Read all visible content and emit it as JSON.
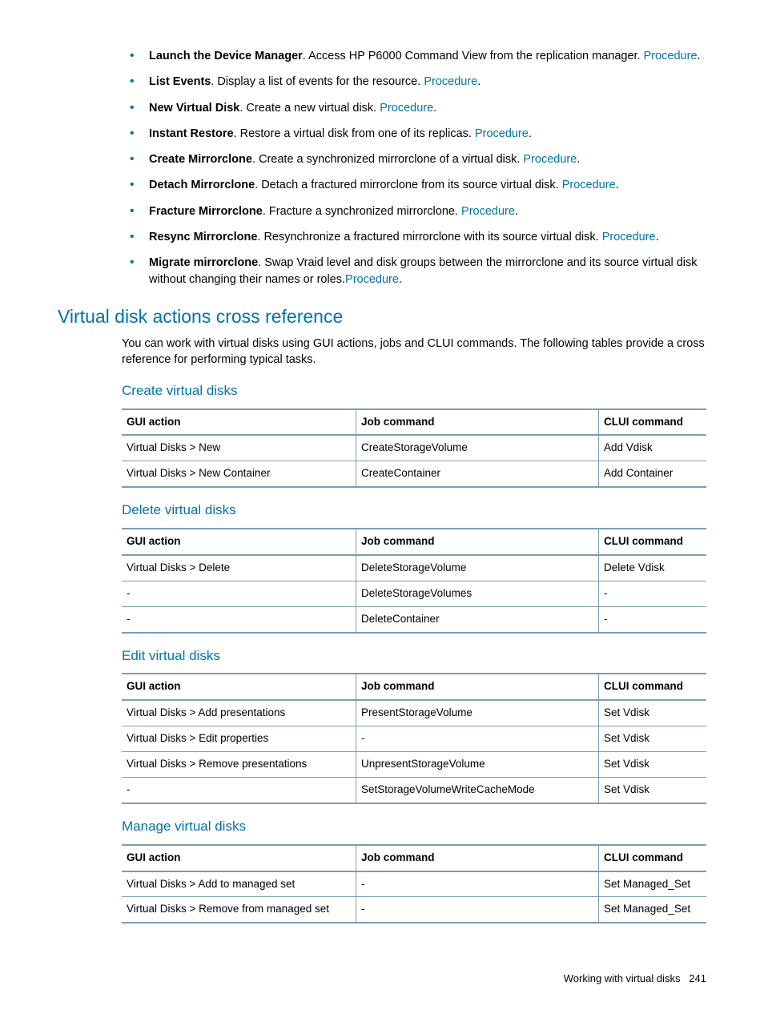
{
  "bullets": [
    {
      "title": "Launch the Device Manager",
      "desc": ". Access HP P6000 Command View from the replication manager. ",
      "link": "Procedure",
      "tail": "."
    },
    {
      "title": "List Events",
      "desc": ". Display a list of events for the resource. ",
      "link": "Procedure",
      "tail": "."
    },
    {
      "title": "New Virtual Disk",
      "desc": ". Create a new virtual disk. ",
      "link": "Procedure",
      "tail": "."
    },
    {
      "title": "Instant Restore",
      "desc": ". Restore a virtual disk from one of its replicas. ",
      "link": "Procedure",
      "tail": "."
    },
    {
      "title": "Create Mirrorclone",
      "desc": ". Create a synchronized mirrorclone of a virtual disk. ",
      "link": "Procedure",
      "tail": "."
    },
    {
      "title": "Detach Mirrorclone",
      "desc": ". Detach a fractured mirrorclone from its source virtual disk. ",
      "link": "Procedure",
      "tail": "."
    },
    {
      "title": "Fracture Mirrorclone",
      "desc": ". Fracture a synchronized mirrorclone. ",
      "link": "Procedure",
      "tail": "."
    },
    {
      "title": "Resync Mirrorclone",
      "desc": ". Resynchronize a fractured mirrorclone with its source virtual disk. ",
      "link": "Procedure",
      "tail": "."
    },
    {
      "title": "Migrate mirrorclone",
      "desc": ". Swap Vraid level and disk groups between the mirrorclone and its source virtual disk without changing their names or roles.",
      "link": "Procedure",
      "tail": "."
    }
  ],
  "section_title": "Virtual disk actions cross reference",
  "intro": "You can work with virtual disks using GUI actions, jobs and CLUI commands. The following tables provide a cross reference for performing typical tasks.",
  "columns": {
    "c1": "GUI action",
    "c2": "Job command",
    "c3": "CLUI command"
  },
  "tables": {
    "create": {
      "title": "Create virtual disks",
      "rows": [
        {
          "c1": "Virtual Disks > New",
          "c2": "CreateStorageVolume",
          "c3": "Add Vdisk"
        },
        {
          "c1": "Virtual Disks > New Container",
          "c2": "CreateContainer",
          "c3": "Add Container"
        }
      ]
    },
    "delete": {
      "title": "Delete virtual disks",
      "rows": [
        {
          "c1": "Virtual Disks > Delete",
          "c2": "DeleteStorageVolume",
          "c3": "Delete Vdisk"
        },
        {
          "c1": "-",
          "c2": "DeleteStorageVolumes",
          "c3": "-"
        },
        {
          "c1": "-",
          "c2": "DeleteContainer",
          "c3": "-"
        }
      ]
    },
    "edit": {
      "title": "Edit virtual disks",
      "rows": [
        {
          "c1": "Virtual Disks > Add presentations",
          "c2": "PresentStorageVolume",
          "c3": "Set Vdisk"
        },
        {
          "c1": "Virtual Disks > Edit properties",
          "c2": "-",
          "c3": "Set Vdisk"
        },
        {
          "c1": "Virtual Disks > Remove presentations",
          "c2": "UnpresentStorageVolume",
          "c3": "Set Vdisk"
        },
        {
          "c1": "-",
          "c2": "SetStorageVolumeWriteCacheMode",
          "c3": "Set Vdisk"
        }
      ]
    },
    "manage": {
      "title": "Manage virtual disks",
      "rows": [
        {
          "c1": "Virtual Disks > Add to managed set",
          "c2": "-",
          "c3": "Set Managed_Set"
        },
        {
          "c1": "Virtual Disks > Remove from managed set",
          "c2": "-",
          "c3": "Set Managed_Set"
        }
      ]
    }
  },
  "footer": {
    "label": "Working with virtual disks",
    "page": "241"
  }
}
